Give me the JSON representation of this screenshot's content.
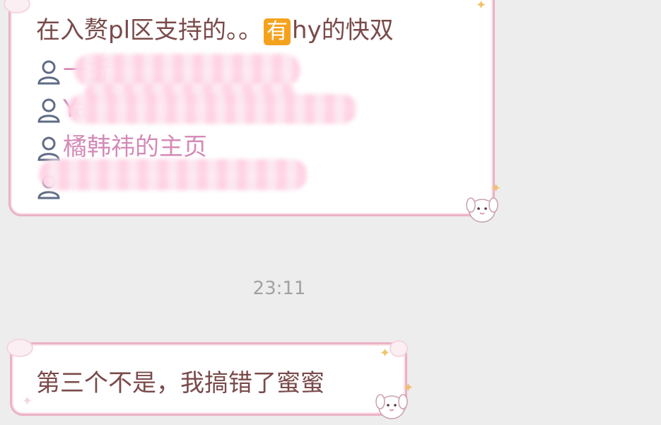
{
  "chat": {
    "message_1": {
      "line_1_before": "在入赘pl区支持的。。",
      "badge_you": "有",
      "line_1_after": "hy的快双",
      "mentions": [
        {
          "label": "一折"
        },
        {
          "label": "Ya"
        },
        {
          "label": "橘韩祎的主页"
        },
        {
          "label": ""
        }
      ]
    },
    "timestamp": "23:11",
    "message_2": {
      "text": "第三个不是，我搞错了蜜蜜"
    }
  },
  "colors": {
    "background": "#ededed",
    "bubble_border": "#eab3c4",
    "message_text": "#7a4a4a",
    "mention_text": "#d48ab7",
    "timestamp_text": "#a1a1a1",
    "badge_orange": "#f4a21e"
  },
  "icons": {
    "mention_icon": "person-outline-icon",
    "sticker": "puppy-sticker-icon",
    "sparkle": "sparkle-icon"
  }
}
